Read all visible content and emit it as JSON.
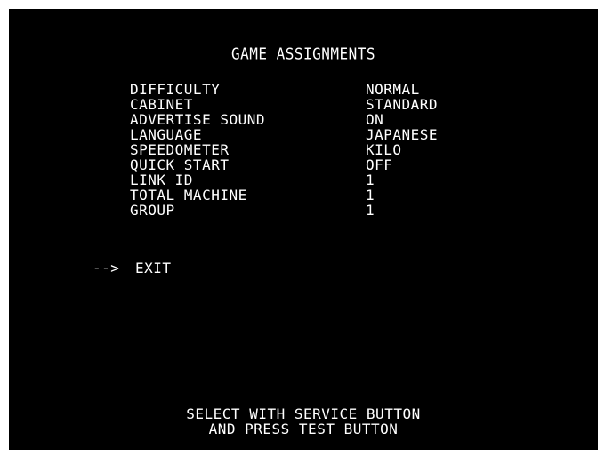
{
  "screen": {
    "title": "GAME ASSIGNMENTS",
    "settings": [
      {
        "label": "DIFFICULTY",
        "value": "NORMAL"
      },
      {
        "label": "CABINET",
        "value": "STANDARD"
      },
      {
        "label": "ADVERTISE SOUND",
        "value": "ON"
      },
      {
        "label": "LANGUAGE",
        "value": "JAPANESE"
      },
      {
        "label": "SPEEDOMETER",
        "value": "KILO"
      },
      {
        "label": "QUICK START",
        "value": "OFF"
      },
      {
        "label": "LINK_ID",
        "value": "1"
      },
      {
        "label": "TOTAL MACHINE",
        "value": "1"
      },
      {
        "label": "GROUP",
        "value": "1"
      }
    ],
    "cursor": "-->",
    "exit_label": "EXIT",
    "footer": {
      "line1": "SELECT WITH SERVICE BUTTON",
      "line2": "AND PRESS TEST BUTTON"
    }
  }
}
